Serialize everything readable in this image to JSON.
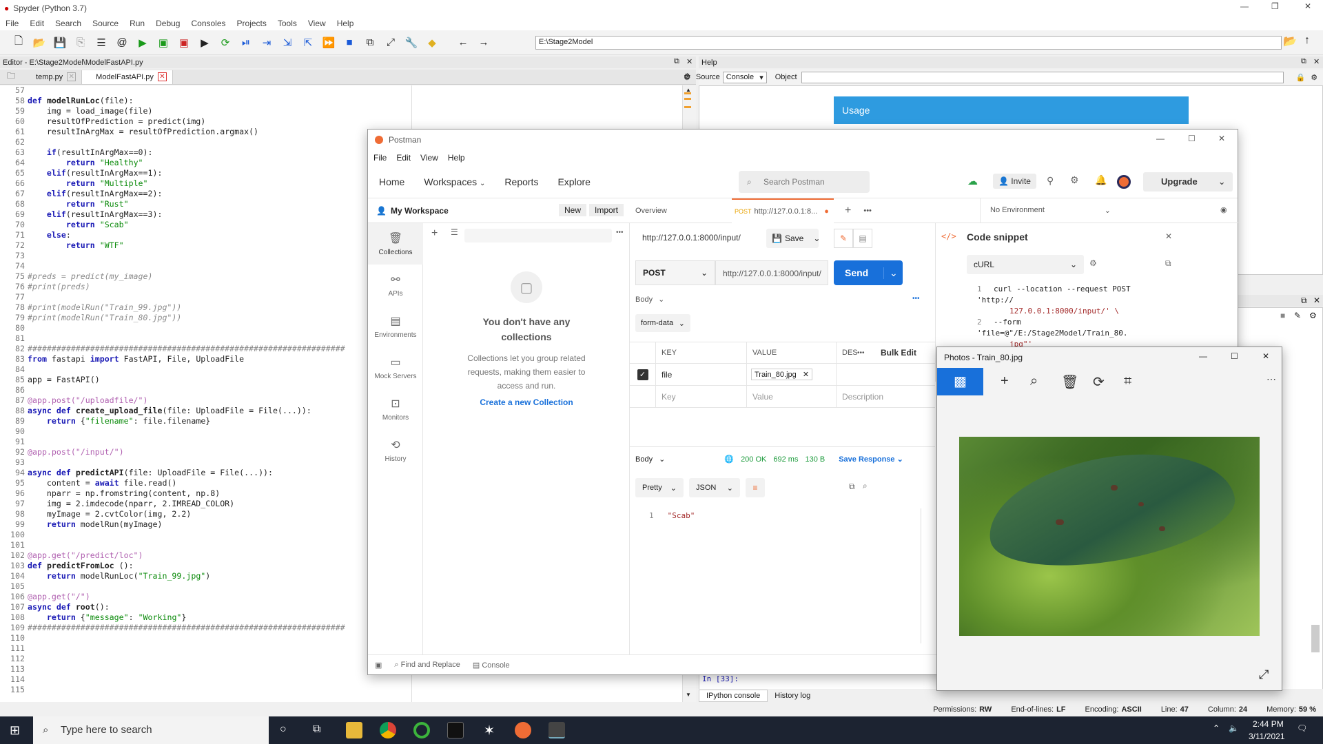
{
  "spyder": {
    "title": "Spyder (Python 3.7)",
    "menu": [
      "File",
      "Edit",
      "Search",
      "Source",
      "Run",
      "Debug",
      "Consoles",
      "Projects",
      "Tools",
      "View",
      "Help"
    ],
    "path": "E:\\Stage2Model",
    "editor_title": "Editor - E:\\Stage2Model\\ModelFastAPI.py",
    "tabs": [
      "temp.py",
      "ModelFastAPI.py"
    ],
    "help_title": "Help",
    "help_source_label": "Source",
    "help_source_value": "Console",
    "help_object_label": "Object",
    "usage_title": "Usage",
    "console_prompt": "In [33]:",
    "console_tabs": [
      "IPython console",
      "History log"
    ],
    "status": {
      "permissions": "Permissions:",
      "permissions_val": "RW",
      "eol": "End-of-lines:",
      "eol_val": "LF",
      "encoding": "Encoding:",
      "encoding_val": "ASCII",
      "line": "Line:",
      "line_val": "47",
      "column": "Column:",
      "column_val": "24",
      "memory": "Memory:",
      "memory_val": "59 %"
    }
  },
  "code_lines": [
    {
      "n": "57",
      "t": ""
    },
    {
      "n": "58",
      "t": "def modelRunLoc(file):"
    },
    {
      "n": "59",
      "t": "    img = load_image(file)"
    },
    {
      "n": "60",
      "t": "    resultOfPrediction = predict(img)"
    },
    {
      "n": "61",
      "t": "    resultInArgMax = resultOfPrediction.argmax()"
    },
    {
      "n": "62",
      "t": ""
    },
    {
      "n": "63",
      "t": "    if(resultInArgMax==0):"
    },
    {
      "n": "64",
      "t": "        return \"Healthy\""
    },
    {
      "n": "65",
      "t": "    elif(resultInArgMax==1):"
    },
    {
      "n": "66",
      "t": "        return \"Multiple\""
    },
    {
      "n": "67",
      "t": "    elif(resultInArgMax==2):"
    },
    {
      "n": "68",
      "t": "        return \"Rust\""
    },
    {
      "n": "69",
      "t": "    elif(resultInArgMax==3):"
    },
    {
      "n": "70",
      "t": "        return \"Scab\""
    },
    {
      "n": "71",
      "t": "    else:"
    },
    {
      "n": "72",
      "t": "        return \"WTF\""
    },
    {
      "n": "73",
      "t": ""
    },
    {
      "n": "74",
      "t": ""
    },
    {
      "n": "75",
      "t": "#preds = predict(my_image)"
    },
    {
      "n": "76",
      "t": "#print(preds)"
    },
    {
      "n": "77",
      "t": ""
    },
    {
      "n": "78",
      "t": "#print(modelRun(\"Train_99.jpg\"))"
    },
    {
      "n": "79",
      "t": "#print(modelRun(\"Train_80.jpg\"))"
    },
    {
      "n": "80",
      "t": ""
    },
    {
      "n": "81",
      "t": ""
    },
    {
      "n": "82",
      "t": "##################################################################"
    },
    {
      "n": "83",
      "t": "from fastapi import FastAPI, File, UploadFile"
    },
    {
      "n": "84",
      "t": ""
    },
    {
      "n": "85",
      "t": "app = FastAPI()"
    },
    {
      "n": "86",
      "t": ""
    },
    {
      "n": "87",
      "t": "@app.post(\"/uploadfile/\")"
    },
    {
      "n": "88",
      "t": "async def create_upload_file(file: UploadFile = File(...)):"
    },
    {
      "n": "89",
      "t": "    return {\"filename\": file.filename}"
    },
    {
      "n": "90",
      "t": ""
    },
    {
      "n": "91",
      "t": ""
    },
    {
      "n": "92",
      "t": "@app.post(\"/input/\")"
    },
    {
      "n": "93",
      "t": ""
    },
    {
      "n": "94",
      "t": "async def predictAPI(file: UploadFile = File(...)):"
    },
    {
      "n": "95",
      "t": "    content = await file.read()"
    },
    {
      "n": "96",
      "t": "    nparr = np.fromstring(content, np.uint8)"
    },
    {
      "n": "97",
      "t": "    img = cv2.imdecode(nparr, cv2.IMREAD_COLOR)"
    },
    {
      "n": "98",
      "t": "    myImage = cv2.cvtColor(img, cv2.COLOR_BGR2RGB)"
    },
    {
      "n": "99",
      "t": "    return modelRun(myImage)"
    },
    {
      "n": "100",
      "t": ""
    },
    {
      "n": "101",
      "t": ""
    },
    {
      "n": "102",
      "t": "@app.get(\"/predict/loc\")"
    },
    {
      "n": "103",
      "t": "def predictFromLoc ():"
    },
    {
      "n": "104",
      "t": "    return modelRunLoc(\"Train_99.jpg\")"
    },
    {
      "n": "105",
      "t": ""
    },
    {
      "n": "106",
      "t": "@app.get(\"/\")"
    },
    {
      "n": "107",
      "t": "async def root():"
    },
    {
      "n": "108",
      "t": "    return {\"message\": \"Working\"}"
    },
    {
      "n": "109",
      "t": "##################################################################"
    },
    {
      "n": "110",
      "t": ""
    },
    {
      "n": "111",
      "t": ""
    },
    {
      "n": "112",
      "t": ""
    },
    {
      "n": "113",
      "t": ""
    },
    {
      "n": "114",
      "t": ""
    },
    {
      "n": "115",
      "t": ""
    }
  ],
  "postman": {
    "title": "Postman",
    "menu": [
      "File",
      "Edit",
      "View",
      "Help"
    ],
    "nav": {
      "home": "Home",
      "workspaces": "Workspaces",
      "reports": "Reports",
      "explore": "Explore"
    },
    "search_placeholder": "Search Postman",
    "invite": "Invite",
    "upgrade": "Upgrade",
    "workspace": "My Workspace",
    "new": "New",
    "import": "Import",
    "tab_overview": "Overview",
    "tab_request_method": "POST",
    "tab_request_url": "http://127.0.0.1:8...",
    "environment": "No Environment",
    "sidebar": [
      "Collections",
      "APIs",
      "Environments",
      "Mock Servers",
      "Monitors",
      "History"
    ],
    "empty_title": "You don't have any collections",
    "empty_body": "Collections let you group related requests, making them easier to access and run.",
    "create_link": "Create a new Collection",
    "request_name": "http://127.0.0.1:8000/input/",
    "save": "Save",
    "method": "POST",
    "url": "http://127.0.0.1:8000/input/",
    "send": "Send",
    "body_label": "Body",
    "body_type": "form-data",
    "col_key": "KEY",
    "col_value": "VALUE",
    "col_desc": "DES",
    "bulk_edit": "Bulk Edit",
    "row_key": "file",
    "row_value": "Train_80.jpg",
    "ph_key": "Key",
    "ph_value": "Value",
    "ph_desc": "Description",
    "resp_body": "Body",
    "resp_status": "200 OK",
    "resp_time": "692 ms",
    "resp_size": "130 B",
    "save_response": "Save Response",
    "pretty": "Pretty",
    "json": "JSON",
    "resp_line_no": "1",
    "resp_value": "\"Scab\"",
    "snippet_title": "Code snippet",
    "snippet_lang": "cURL",
    "snippet_l1_no": "1",
    "snippet_l1": "curl --location --request POST 'http://",
    "snippet_l1b": "127.0.0.1:8000/input/' \\",
    "snippet_l2_no": "2",
    "snippet_l2": "--form 'file=@\"/E:/Stage2Model/Train_80.",
    "snippet_l2b": "jpg\"'",
    "footer_find": "Find and Replace",
    "footer_console": "Console"
  },
  "photos": {
    "title": "Photos - Train_80.jpg"
  },
  "taskbar": {
    "search_placeholder": "Type here to search",
    "time": "2:44 PM",
    "date": "3/11/2021"
  }
}
